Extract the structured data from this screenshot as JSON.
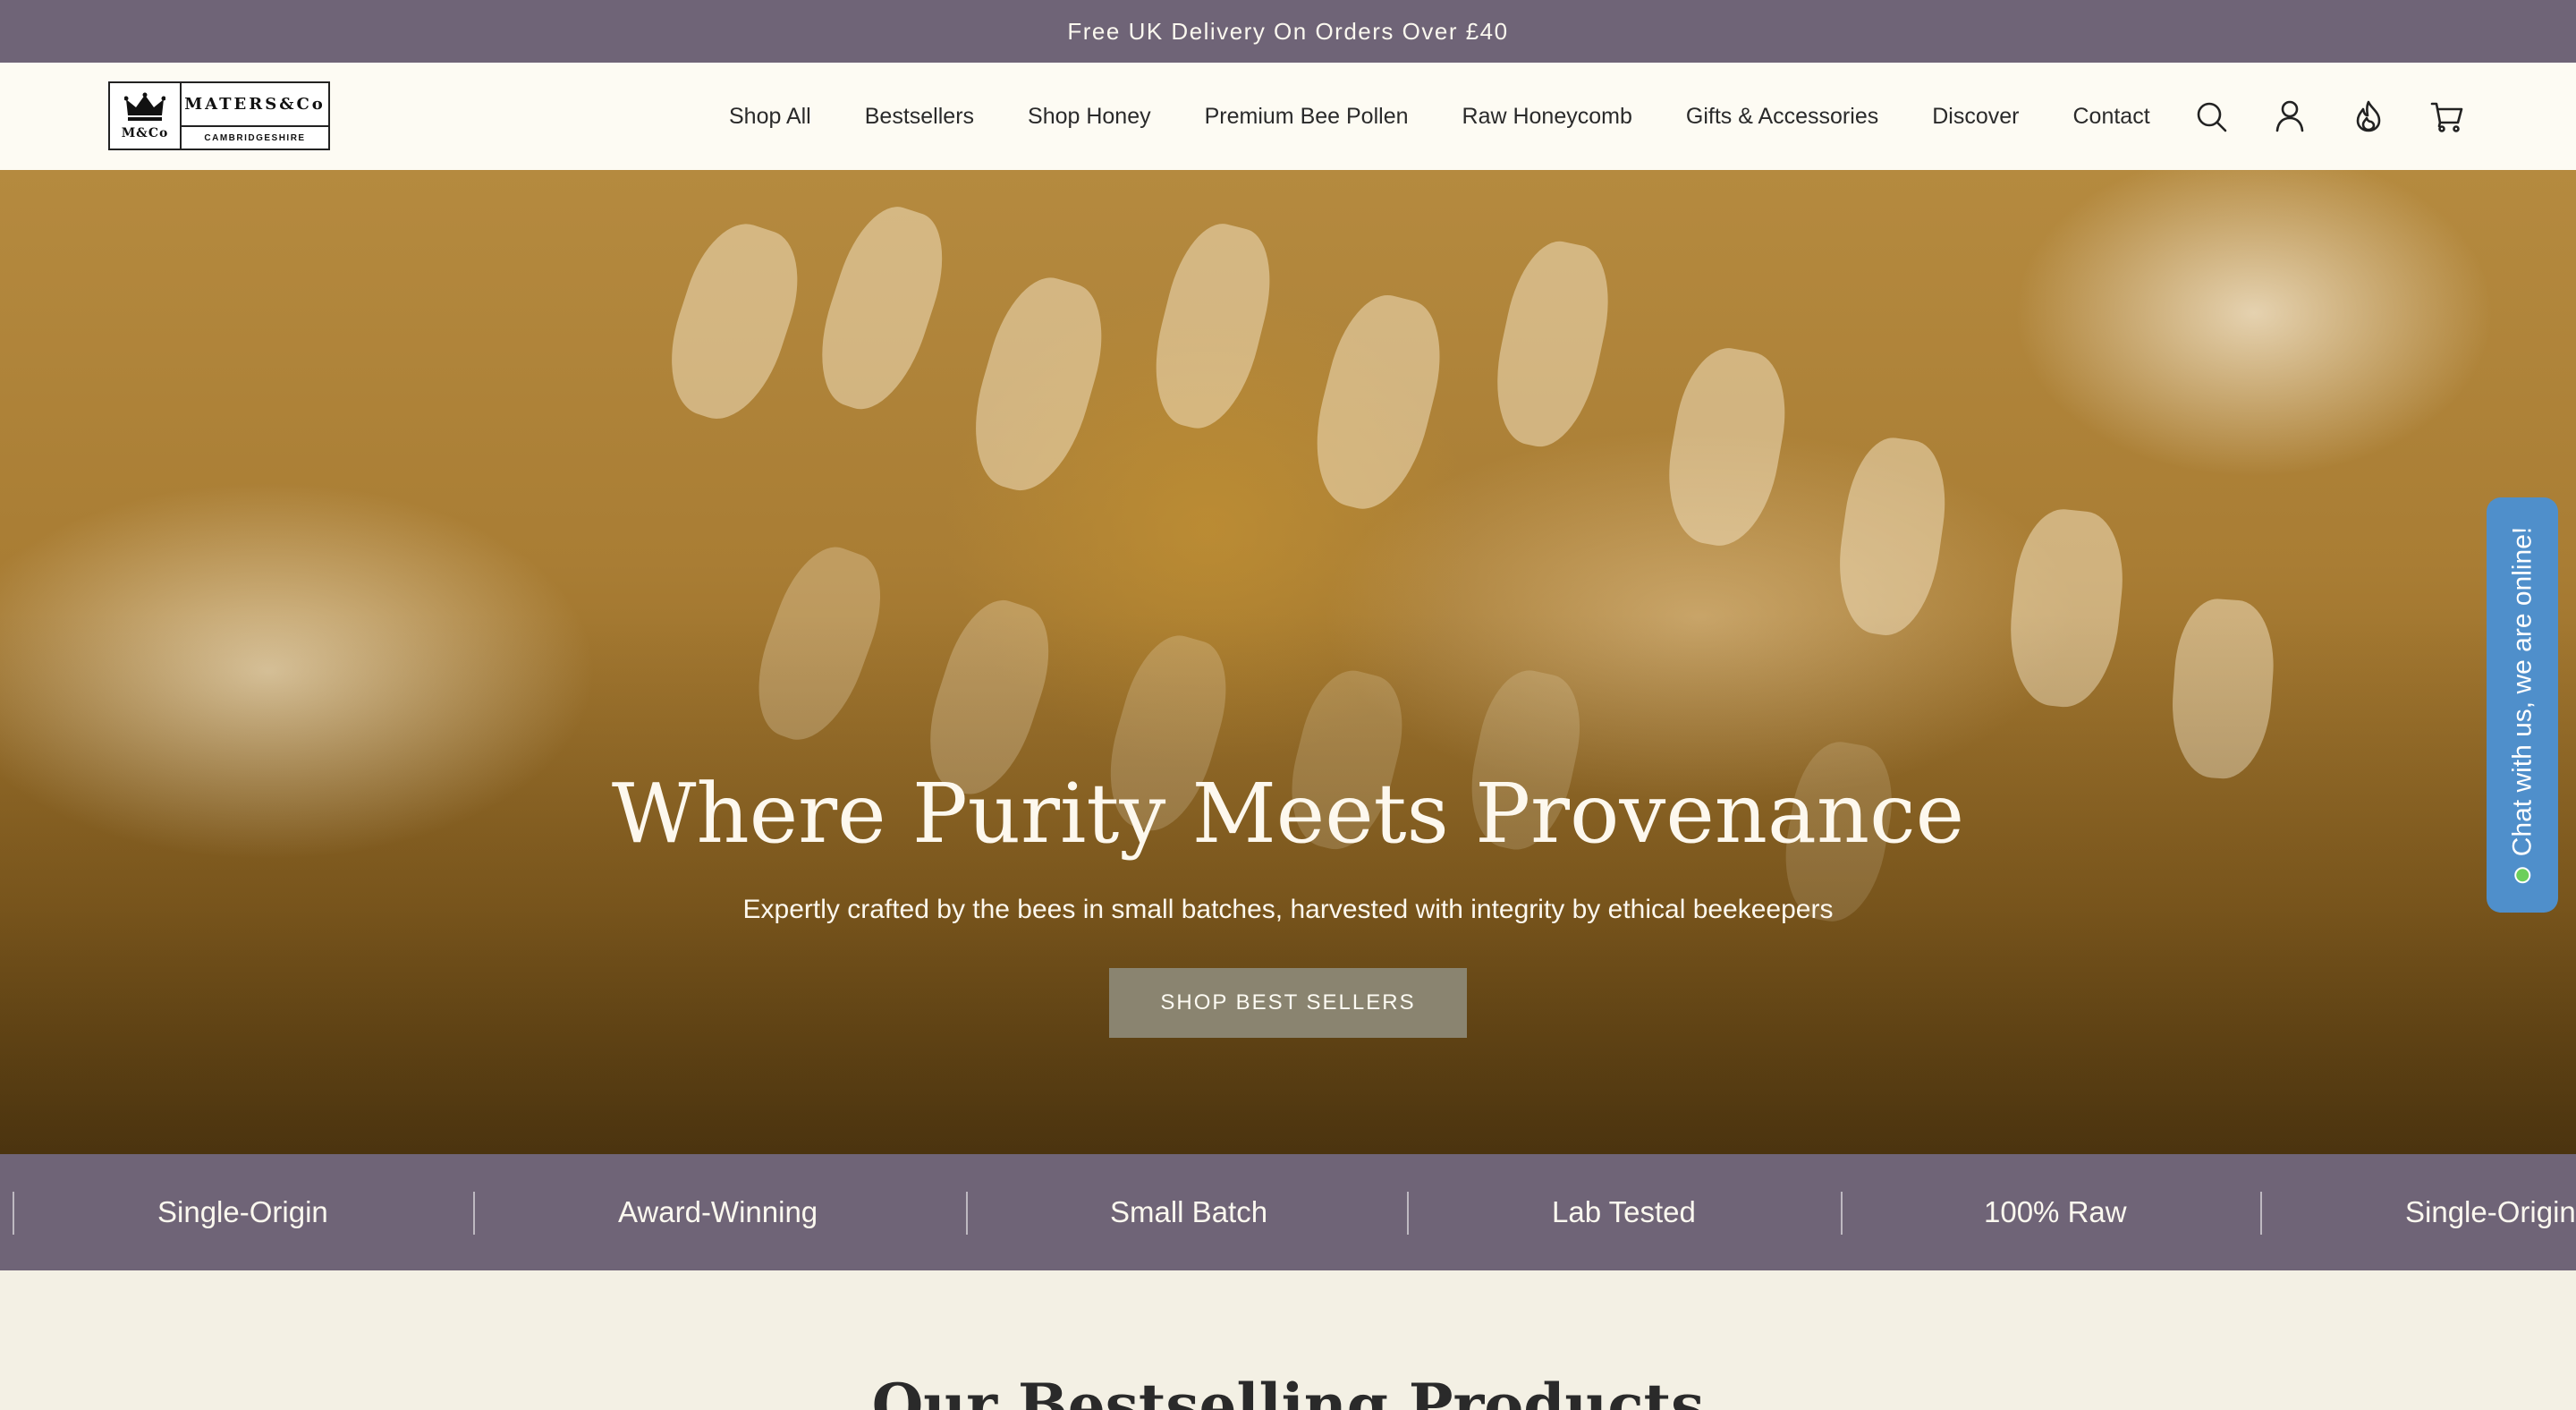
{
  "announcement": {
    "text": "Free UK Delivery On Orders Over £40"
  },
  "logo": {
    "name": "MATERS&Co",
    "monogram": "M&Co",
    "location": "CAMBRIDGESHIRE"
  },
  "nav": {
    "items": [
      {
        "label": "Shop All"
      },
      {
        "label": "Bestsellers"
      },
      {
        "label": "Shop Honey"
      },
      {
        "label": "Premium Bee Pollen"
      },
      {
        "label": "Raw Honeycomb"
      },
      {
        "label": "Gifts & Accessories"
      },
      {
        "label": "Discover"
      },
      {
        "label": "Contact"
      }
    ]
  },
  "header_icons": [
    "search-icon",
    "account-icon",
    "rewards-flame-icon",
    "cart-icon"
  ],
  "hero": {
    "title": "Where Purity Meets Provenance",
    "subtitle": "Expertly crafted by the bees in small batches, harvested with integrity by ethical beekeepers",
    "cta": "SHOP BEST SELLERS"
  },
  "chat": {
    "label": "Chat with us, we are online!"
  },
  "features": {
    "items": [
      {
        "label": "Single-Origin"
      },
      {
        "label": "Award-Winning"
      },
      {
        "label": "Small Batch"
      },
      {
        "label": "Lab Tested"
      },
      {
        "label": "100% Raw"
      },
      {
        "label": "Single-Origin"
      }
    ]
  },
  "section": {
    "title": "Our Bestselling Products"
  },
  "colors": {
    "announce_bg": "#6f6477",
    "header_bg": "#fdfbf3",
    "cta_bg": "#8a8470",
    "chat_bg": "#4f8fcb",
    "page_bg": "#f3f0e4"
  }
}
